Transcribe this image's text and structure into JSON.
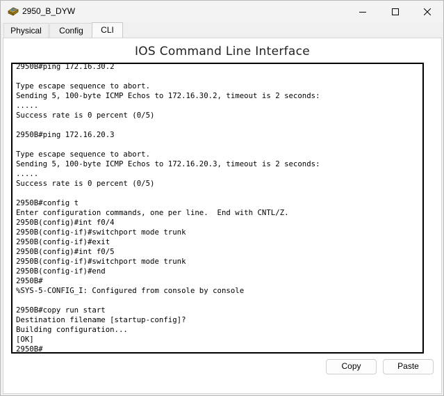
{
  "window": {
    "title": "2950_B_DYW"
  },
  "tabs": [
    {
      "label": "Physical"
    },
    {
      "label": "Config"
    },
    {
      "label": "CLI"
    }
  ],
  "cli": {
    "heading": "IOS Command Line Interface",
    "lines": [
      "2950B#ping 172.16.30.2",
      "",
      "Type escape sequence to abort.",
      "Sending 5, 100-byte ICMP Echos to 172.16.30.2, timeout is 2 seconds:",
      ".....",
      "Success rate is 0 percent (0/5)",
      "",
      "2950B#ping 172.16.20.3",
      "",
      "Type escape sequence to abort.",
      "Sending 5, 100-byte ICMP Echos to 172.16.20.3, timeout is 2 seconds:",
      ".....",
      "Success rate is 0 percent (0/5)",
      "",
      "2950B#config t",
      "Enter configuration commands, one per line.  End with CNTL/Z.",
      "2950B(config)#int f0/4",
      "2950B(config-if)#switchport mode trunk",
      "2950B(config-if)#exit",
      "2950B(config)#int f0/5",
      "2950B(config-if)#switchport mode trunk",
      "2950B(config-if)#end",
      "2950B#",
      "%SYS-5-CONFIG_I: Configured from console by console",
      "",
      "2950B#copy run start",
      "Destination filename [startup-config]?",
      "Building configuration...",
      "[OK]",
      "2950B#"
    ]
  },
  "buttons": {
    "copy": "Copy",
    "paste": "Paste"
  },
  "icons": {
    "app": "packet-tracer-switch-icon",
    "minimize": "minimize-icon",
    "maximize": "maximize-icon",
    "close": "close-icon"
  }
}
